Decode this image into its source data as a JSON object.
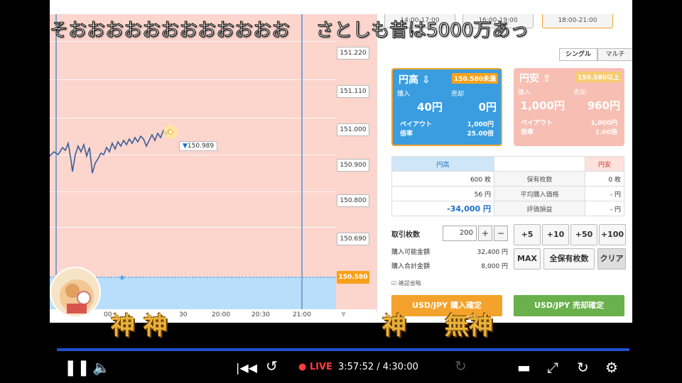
{
  "chart": {
    "price_levels": [
      "151.220",
      "151.110",
      "151.000",
      "150.900",
      "150.800",
      "150.690",
      "150.580"
    ],
    "current_price": "150.580",
    "tooltip_value": "150.989",
    "time_ticks": [
      "00",
      "30",
      "20:00",
      "20:30",
      "21:00"
    ]
  },
  "sessions": [
    "14:00-17:00",
    "16:00-19:00",
    "18:00-21:00"
  ],
  "modes": [
    "シングル",
    "マルチ"
  ],
  "card_up": {
    "title": "円高",
    "rate": "150.580未満",
    "buy_label": "購入",
    "sell_label": "売却",
    "buy_value": "40円",
    "sell_value": "0円",
    "payout_label": "ペイアウト",
    "payout_value": "1,000円",
    "multiple_label": "倍率",
    "multiple_value": "25.00倍"
  },
  "card_down": {
    "title": "円安",
    "rate": "150.580以上",
    "buy_label": "購入",
    "sell_label": "売却",
    "buy_value": "1,000円",
    "sell_value": "960円",
    "payout_label": "ペイアウト",
    "payout_value": "1,000円",
    "multiple_label": "倍率",
    "multiple_value": "1.00倍"
  },
  "positions": {
    "head_up": "円高",
    "head_down": "円安",
    "rows": [
      {
        "up": "600 枚",
        "label": "保有枚数",
        "down": "0 枚"
      },
      {
        "up": "56 円",
        "label": "平均購入価格",
        "down": "- 円"
      },
      {
        "up": "-34,000 円",
        "label": "評価損益",
        "down": "- 円"
      }
    ]
  },
  "order": {
    "lots_label": "取引枚数",
    "lots_value": "200",
    "available_label": "購入可能金額",
    "available_value": "32,400 円",
    "total_label": "購入合計金額",
    "total_value": "8,000 円",
    "plus": "+",
    "minus": "−",
    "quick": [
      "+5",
      "+10",
      "+50",
      "+100"
    ],
    "max": "MAX",
    "all": "全保有枚数",
    "clear": "クリア",
    "skip_confirm": "確認省略",
    "buy_confirm": "USD/JPY 購入確定",
    "sell_confirm": "USD/JPY 売却確定"
  },
  "danmaku": {
    "top": [
      "そおおおおおおおおおおおお",
      "さとしも昔は5000万あっ"
    ],
    "gold": [
      "神 神",
      "神",
      "無神"
    ]
  },
  "player": {
    "live": "LIVE",
    "time": "3:57:52 / 4:30:00"
  }
}
